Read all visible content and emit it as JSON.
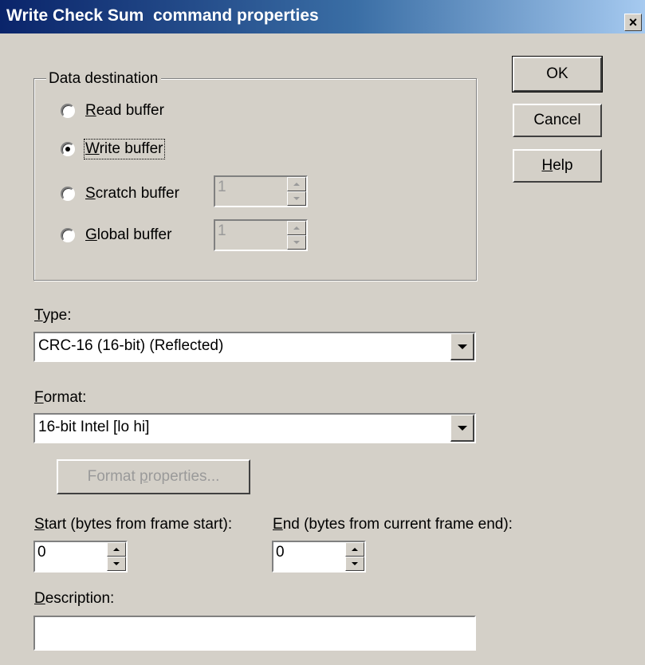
{
  "window": {
    "title": "Write Check Sum  command properties",
    "close_glyph": "×"
  },
  "data_destination": {
    "label": "Data destination",
    "options": [
      {
        "label": "Read buffer",
        "mnemonic": "R",
        "rest": "ead buffer",
        "checked": false
      },
      {
        "label": "Write buffer",
        "mnemonic": "W",
        "rest": "rite buffer",
        "checked": true
      },
      {
        "label": "Scratch buffer",
        "mnemonic": "S",
        "rest": "cratch buffer",
        "checked": false
      },
      {
        "label": "Global buffer",
        "mnemonic": "G",
        "rest": "lobal buffer",
        "checked": false
      }
    ],
    "scratch_value": "1",
    "global_value": "1"
  },
  "buttons": {
    "ok": "OK",
    "cancel": "Cancel",
    "help_m": "H",
    "help_rest": "elp"
  },
  "type": {
    "label_m": "T",
    "label_rest": "ype:",
    "value": "CRC-16  (16-bit) (Reflected)"
  },
  "format": {
    "label_m": "F",
    "label_rest": "ormat:",
    "value": "16-bit Intel  [lo hi]"
  },
  "format_properties": {
    "pre": "Format ",
    "m": "p",
    "rest": "roperties..."
  },
  "start": {
    "label_m": "S",
    "label_rest": "tart (bytes from frame start):",
    "value": "0"
  },
  "end": {
    "label_m": "E",
    "label_rest": "nd (bytes from current frame end):",
    "value": "0"
  },
  "description": {
    "label_m": "D",
    "label_rest": "escription:",
    "value": ""
  }
}
